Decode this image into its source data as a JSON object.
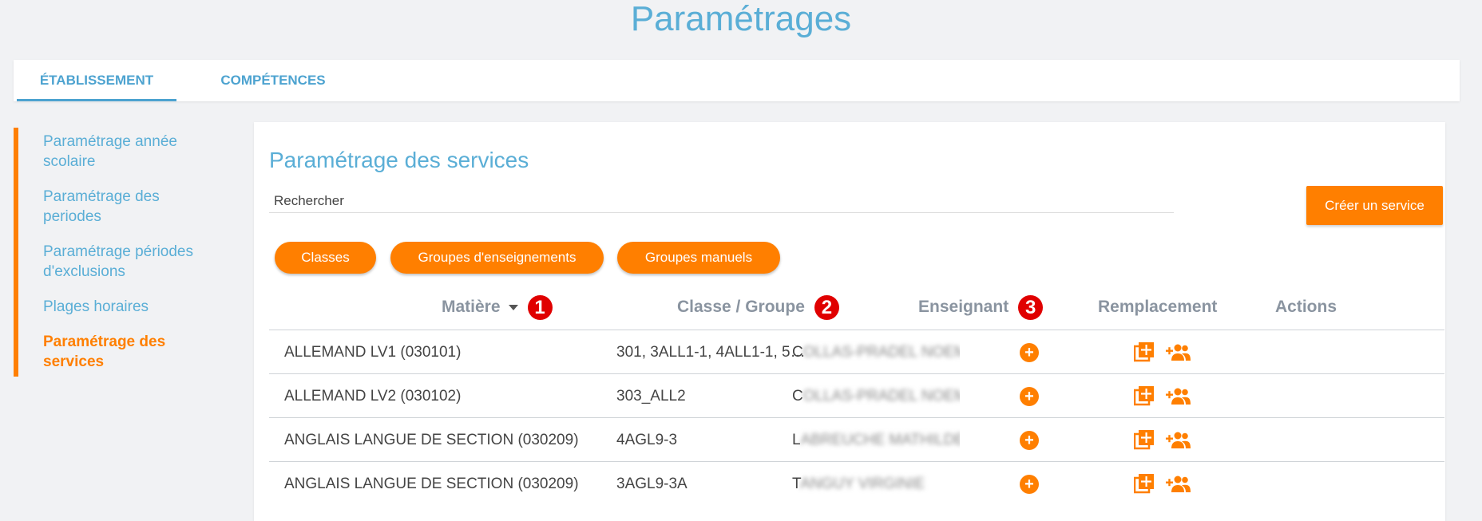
{
  "page_title": "Paramétrages",
  "tabs": [
    {
      "label": "ÉTABLISSEMENT",
      "active": true
    },
    {
      "label": "COMPÉTENCES",
      "active": false
    }
  ],
  "sidebar": {
    "items": [
      {
        "label": "Paramétrage année scolaire"
      },
      {
        "label": "Paramétrage des periodes"
      },
      {
        "label": "Paramétrage périodes d'exclusions"
      },
      {
        "label": "Plages horaires"
      },
      {
        "label": "Paramétrage des services",
        "active": true
      }
    ]
  },
  "main": {
    "title": "Paramétrage des services",
    "search": {
      "placeholder": "Rechercher",
      "value": ""
    },
    "create_button": "Créer un service",
    "filters": [
      "Classes",
      "Groupes d'enseignements",
      "Groupes manuels"
    ],
    "columns": {
      "matiere": "Matière",
      "classe": "Classe / Groupe",
      "enseignant": "Enseignant",
      "remplacement": "Remplacement",
      "actions": "Actions"
    },
    "badges": [
      "1",
      "2",
      "3"
    ],
    "rows": [
      {
        "matiere": "ALLEMAND LV1 (030101)",
        "classe": "301, 3ALL1-1, 4ALL1-1, 5…",
        "enseignant_initial": "C",
        "enseignant_blur": "OLLAS-PRADEL NOEMIE"
      },
      {
        "matiere": "ALLEMAND LV2 (030102)",
        "classe": "303_ALL2",
        "enseignant_initial": "C",
        "enseignant_blur": "OLLAS-PRADEL NOEMIE"
      },
      {
        "matiere": "ANGLAIS LANGUE DE SECTION (030209)",
        "classe": "4AGL9-3",
        "enseignant_initial": "L",
        "enseignant_blur": "ABREUCHE MATHILDE"
      },
      {
        "matiere": "ANGLAIS LANGUE DE SECTION (030209)",
        "classe": "3AGL9-3A",
        "enseignant_initial": "T",
        "enseignant_blur": "ANGUY VIRGINIE"
      }
    ]
  },
  "colors": {
    "accent": "#ff7f00",
    "link": "#5aaed6",
    "badge": "#e00000"
  },
  "icons": [
    "plus-circle-icon",
    "add-to-queue-icon",
    "add-user-group-icon",
    "sort-caret-icon"
  ]
}
